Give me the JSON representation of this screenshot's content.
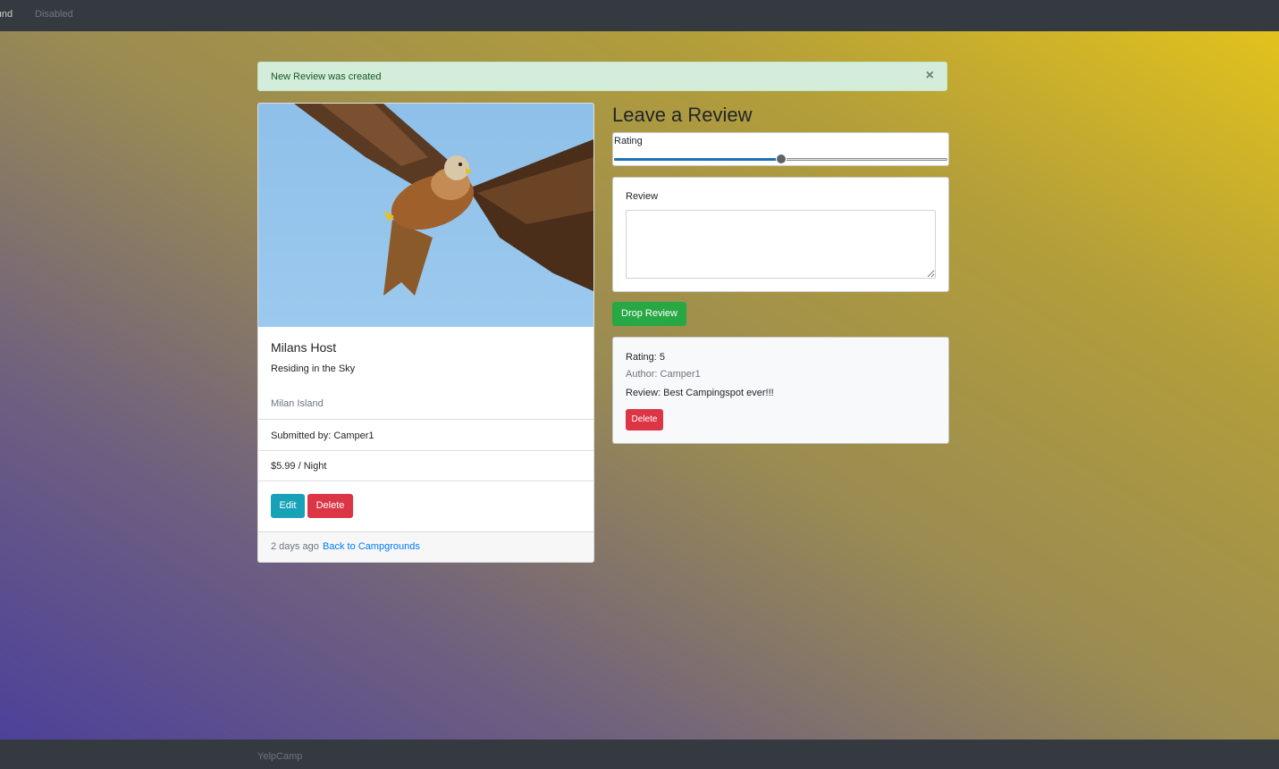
{
  "navbar": {
    "brand_fragment": "round",
    "disabled_link": "Disabled"
  },
  "alert": {
    "message": "New Review was created",
    "close_symbol": "×"
  },
  "campground": {
    "title": "Milans Host",
    "description": "Residing in the Sky",
    "location": "Milan Island",
    "submitted_by": "Submitted by: Camper1",
    "price": "$5.99 / Night",
    "edit_label": "Edit",
    "delete_label": "Delete",
    "time_ago": "2 days ago",
    "back_link": "Back to Campgrounds"
  },
  "review_form": {
    "title": "Leave a Review",
    "rating_label": "Rating",
    "rating_value": 3,
    "rating_max": 5,
    "rating_min": 1,
    "review_label": "Review",
    "review_value": "",
    "submit_label": "Drop Review"
  },
  "reviews": [
    {
      "rating": "Rating: 5",
      "author": "Author: Camper1",
      "text": "Review: Best Campingspot ever!!!",
      "delete_label": "Delete"
    }
  ],
  "footer": {
    "text": "YelpCamp"
  },
  "colors": {
    "navbar_bg": "#343a40",
    "alert_success_bg": "#d4edda",
    "btn_info": "#17a2b8",
    "btn_danger": "#dc3545",
    "btn_success": "#28a745",
    "link": "#007bff"
  }
}
